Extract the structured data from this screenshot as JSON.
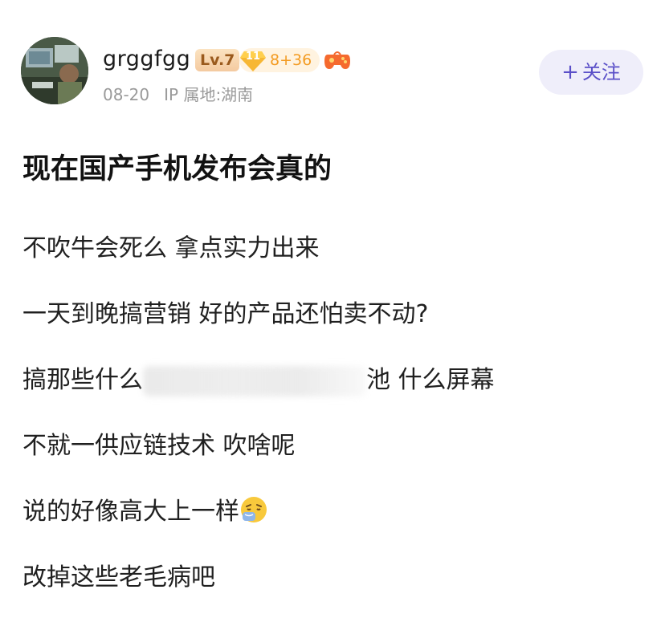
{
  "user": {
    "name": "grggfgg",
    "level": "Lv.7",
    "vip_gem_number": "11",
    "vip_text": "8+36",
    "date": "08-20",
    "ip_location": "IP 属地:湖南"
  },
  "follow_button": {
    "plus": "+",
    "label": "关注"
  },
  "post": {
    "title": "现在国产手机发布会真的",
    "lines": {
      "l1": "不吹牛会死么 拿点实力出来",
      "l2": "一天到晚搞营销 好的产品还怕卖不动?",
      "l3_before": "搞那些什么",
      "l3_after": "池 什么屏幕",
      "l4": "不就一供应链技术 吹啥呢",
      "l5": "说的好像高大上一样",
      "l6": "改掉这些老毛病吧"
    }
  },
  "colors": {
    "follow_text": "#5a4fc8",
    "follow_bg": "#efeefa",
    "vip_orange": "#f39b22",
    "meta_gray": "#9a9a9a"
  },
  "icons": {
    "vip": "diamond-gem-icon",
    "game": "gamepad-icon",
    "emoji": "sneezing-face-emoji"
  }
}
